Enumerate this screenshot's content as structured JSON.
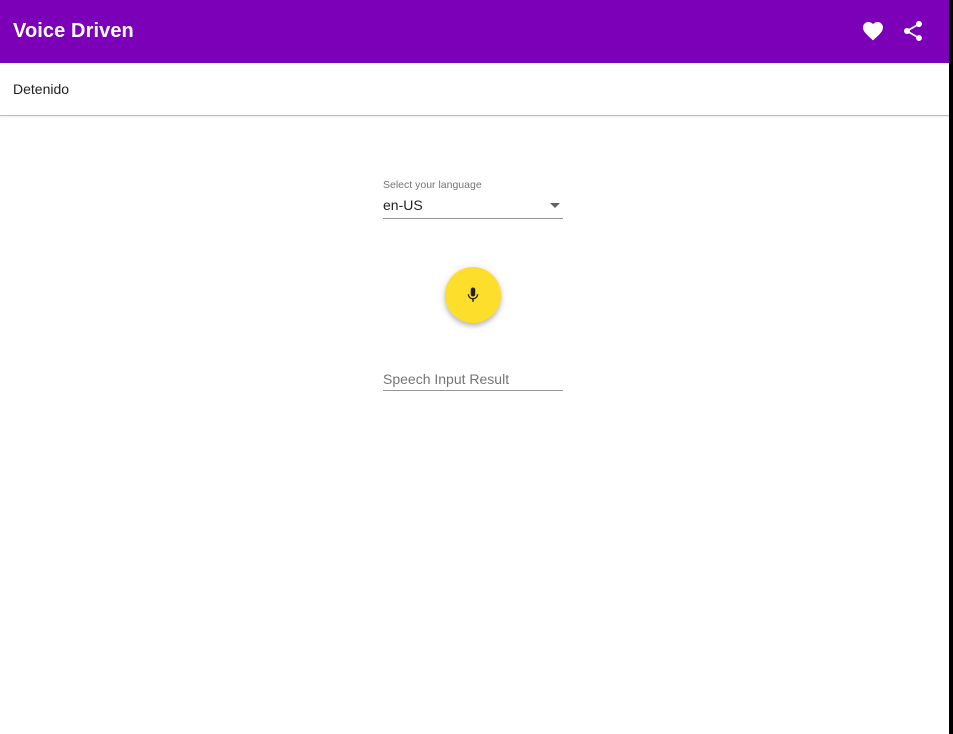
{
  "app_bar": {
    "title": "Voice Driven",
    "background_color": "#7b00b8",
    "actions": [
      {
        "name": "favorite",
        "icon": "heart-icon"
      },
      {
        "name": "share",
        "icon": "share-icon"
      }
    ]
  },
  "status": {
    "text": "Detenido"
  },
  "language_select": {
    "label": "Select your language",
    "selected": "en-US",
    "icon": "dropdown-arrow-icon"
  },
  "mic_button": {
    "icon": "microphone-icon",
    "color": "#fdde2a"
  },
  "speech_result": {
    "value": "",
    "placeholder": "Speech Input Result"
  }
}
